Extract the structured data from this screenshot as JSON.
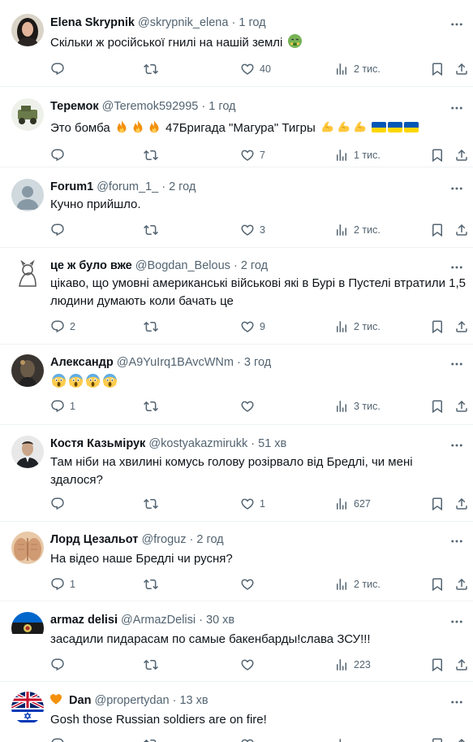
{
  "tweets": [
    {
      "name": "Elena Skrypnik",
      "handle": "@skrypnik_elena",
      "time": "1 год",
      "text": "Скільки ж російської гнилі на нашій землі",
      "reply": "",
      "retweet": "",
      "like": "40",
      "views": "2 тис.",
      "avatar": "photo-woman-dark-hair"
    },
    {
      "name": "Теремок",
      "handle": "@Teremok592995",
      "time": "1 год",
      "text_a": "Это бомба",
      "text_b": "47Бригада \"Магура\" Тигры",
      "reply": "",
      "retweet": "",
      "like": "7",
      "views": "1 тис.",
      "avatar": "military-vehicle"
    },
    {
      "name": "Forum1",
      "handle": "@forum_1_",
      "time": "2 год",
      "text": "Кучно прийшло.",
      "reply": "",
      "retweet": "",
      "like": "3",
      "views": "2 тис.",
      "avatar": "default-profile"
    },
    {
      "name": "це ж було вже",
      "handle": "@Bogdan_Belous",
      "time": "2 год",
      "text": "цікаво, що умовні американські військові які в Бурі в Пустелі втратили 1,5\nлюдини думають коли бачать це",
      "reply": "2",
      "retweet": "",
      "like": "9",
      "views": "2 тис.",
      "avatar": "cat-sketch"
    },
    {
      "name": "Александр",
      "handle": "@A9YuIrq1BAvcWNm",
      "time": "3 год",
      "text": "",
      "reply": "1",
      "retweet": "",
      "like": "",
      "views": "3 тис.",
      "avatar": "photo-dark"
    },
    {
      "name": "Костя Казьмірук",
      "handle": "@kostyakazmirukk",
      "time": "51 хв",
      "text": "Там ніби на хвилині комусь голову розірвало від Бредлі, чи мені\nздалося?",
      "reply": "",
      "retweet": "",
      "like": "1",
      "views": "627",
      "avatar": "photo-man-suit"
    },
    {
      "name": "Лорд Цезальот",
      "handle": "@froguz",
      "time": "2 год",
      "text": "На відео наше Бредлі чи русня?",
      "reply": "1",
      "retweet": "",
      "like": "",
      "views": "2 тис.",
      "avatar": "photo-hands"
    },
    {
      "name": "armaz delisi",
      "handle": "@ArmazDelisi",
      "time": "30 хв",
      "text": "засадили пидарасам по самые бакенбарды!слава ЗСУ!!!",
      "reply": "",
      "retweet": "",
      "like": "",
      "views": "223",
      "avatar": "flag-emblem"
    },
    {
      "name": "Dan",
      "handle": "@propertydan",
      "time": "13 хв",
      "text": "Gosh those Russian soldiers are on fire!",
      "reply": "",
      "retweet": "",
      "like": "",
      "views": "",
      "avatar": "flags-uk-israel"
    }
  ],
  "icons": {
    "reply": "reply-icon",
    "retweet": "retweet-icon",
    "like": "heart-icon",
    "views": "views-icon",
    "bookmark": "bookmark-icon",
    "share": "share-icon",
    "more": "more-icon"
  },
  "colors": {
    "text": "#0f1419",
    "secondary": "#536471",
    "border": "#eff3f4",
    "ukraine_blue": "#0057b7",
    "ukraine_yellow": "#ffd700"
  }
}
